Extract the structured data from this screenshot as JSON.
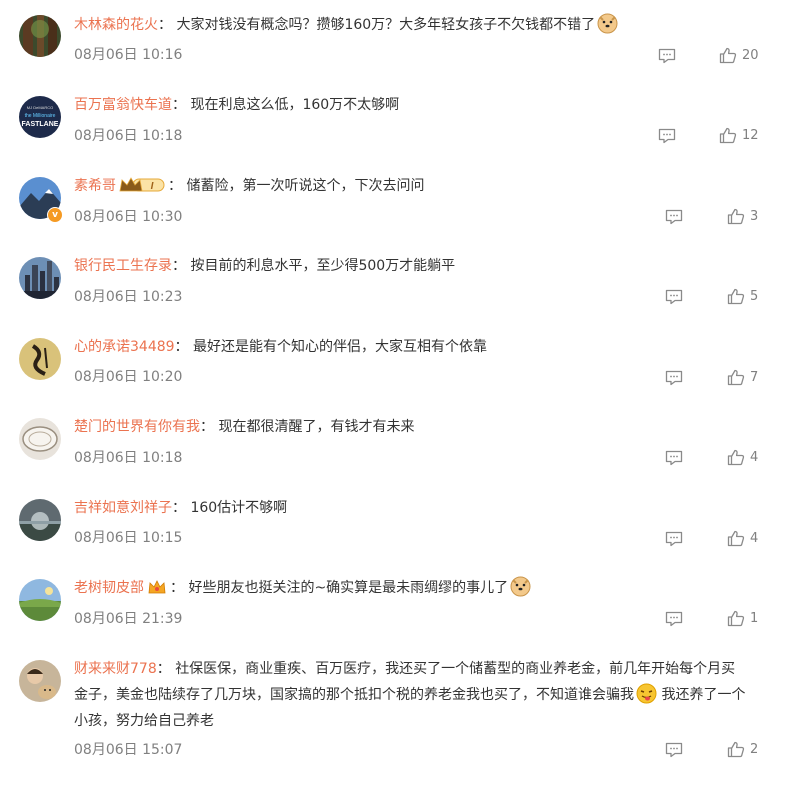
{
  "comments": [
    {
      "user": "木林森的花火",
      "sep": "：",
      "text": "大家对钱没有概念吗？攒够160万？大多年轻女孩子不欠钱都不错了",
      "time": "08月06日 10:16",
      "likes": "20"
    },
    {
      "user": "百万富翁快车道",
      "sep": "：",
      "text": "现在利息这么低，160万不太够啊",
      "time": "08月06日 10:18",
      "likes": "12",
      "avatar_text_1": "MJ DeMARCO",
      "avatar_text_2": "the Millionaire",
      "avatar_text_3": "FASTLANE"
    },
    {
      "user": "素希哥",
      "sep": "：",
      "text": "储蓄险，第一次听说这个，下次去问问",
      "time": "08月06日 10:30",
      "likes": "3",
      "badge": "I"
    },
    {
      "user": "银行民工生存录",
      "sep": "：",
      "text": "按目前的利息水平，至少得500万才能躺平",
      "time": "08月06日 10:23",
      "likes": "5"
    },
    {
      "user": "心的承诺34489",
      "sep": "：",
      "text": "最好还是能有个知心的伴侣，大家互相有个依靠",
      "time": "08月06日 10:20",
      "likes": "7"
    },
    {
      "user": "楚门的世界有你有我",
      "sep": "：",
      "text": "现在都很清醒了，有钱才有未来",
      "time": "08月06日 10:18",
      "likes": "4"
    },
    {
      "user": "吉祥如意刘祥子",
      "sep": "：",
      "text": "160估计不够啊",
      "time": "08月06日 10:15",
      "likes": "4"
    },
    {
      "user": "老树韧皮部",
      "sep": "：",
      "text": "好些朋友也挺关注的~确实算是最未雨绸缪的事儿了",
      "time": "08月06日 21:39",
      "likes": "1"
    },
    {
      "user": "财来来财778",
      "sep": "：",
      "text": "社保医保，商业重疾、百万医疗，我还买了一个储蓄型的商业养老金，前几年开始每个月买金子，美金也陆续存了几万块，国家搞的那个抵扣个税的养老金我也买了，不知道谁会骗我",
      "text2": "我还养了一个小孩，努力给自己养老",
      "time": "08月06日 15:07",
      "likes": "2"
    }
  ],
  "icons": {
    "reply": "comment-icon",
    "like": "thumbs-up-icon"
  },
  "colors": {
    "username": "#eb7350",
    "text": "#333333",
    "meta": "#808080",
    "verified": "#f59a23"
  }
}
